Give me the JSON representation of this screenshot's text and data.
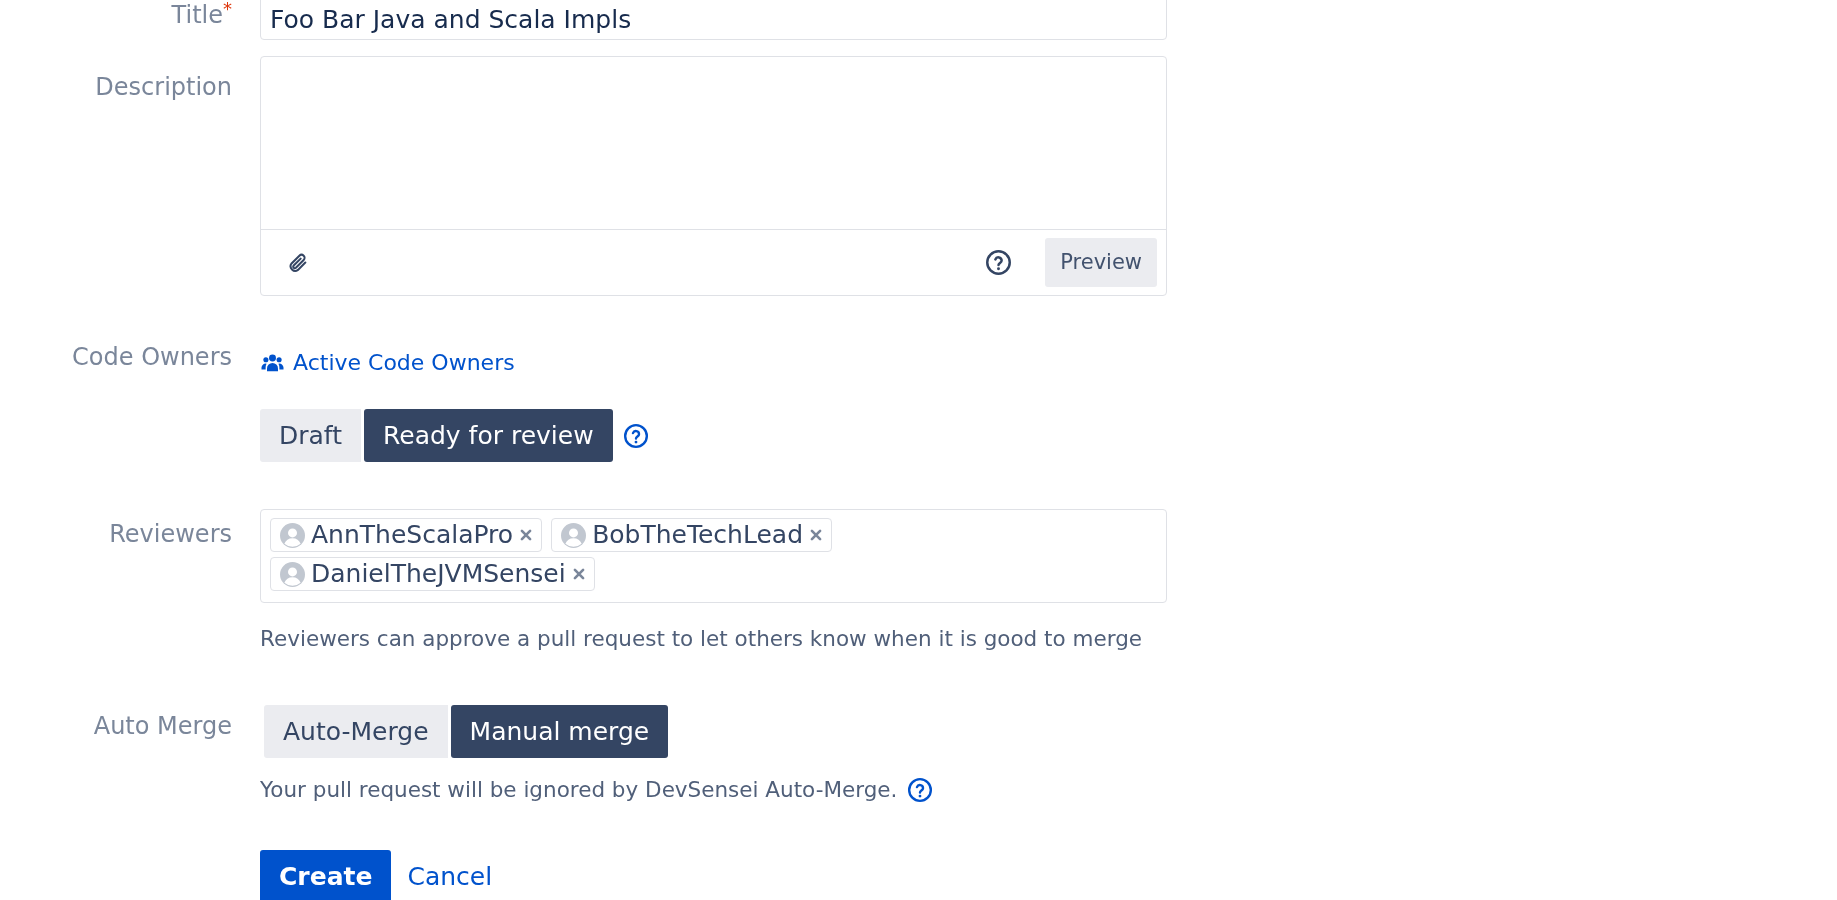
{
  "form": {
    "title": {
      "label": "Title",
      "required_mark": "*",
      "value": "Foo Bar Java and Scala Impls"
    },
    "description": {
      "label": "Description",
      "preview_button": "Preview"
    },
    "code_owners": {
      "label": "Code Owners",
      "link": "Active Code Owners"
    },
    "status_toggle": {
      "options": [
        {
          "label": "Draft",
          "selected": false
        },
        {
          "label": "Ready for review",
          "selected": true
        }
      ]
    },
    "reviewers": {
      "label": "Reviewers",
      "items": [
        {
          "name": "AnnTheScalaPro"
        },
        {
          "name": "BobTheTechLead"
        },
        {
          "name": "DanielTheJVMSensei"
        }
      ],
      "help": "Reviewers can approve a pull request to let others know when it is good to merge"
    },
    "auto_merge": {
      "label": "Auto Merge",
      "options": [
        {
          "label": "Auto-Merge",
          "selected": false
        },
        {
          "label": "Manual merge",
          "selected": true
        }
      ],
      "note": "Your pull request will be ignored by DevSensei Auto-Merge."
    },
    "actions": {
      "create": "Create",
      "cancel": "Cancel"
    }
  }
}
